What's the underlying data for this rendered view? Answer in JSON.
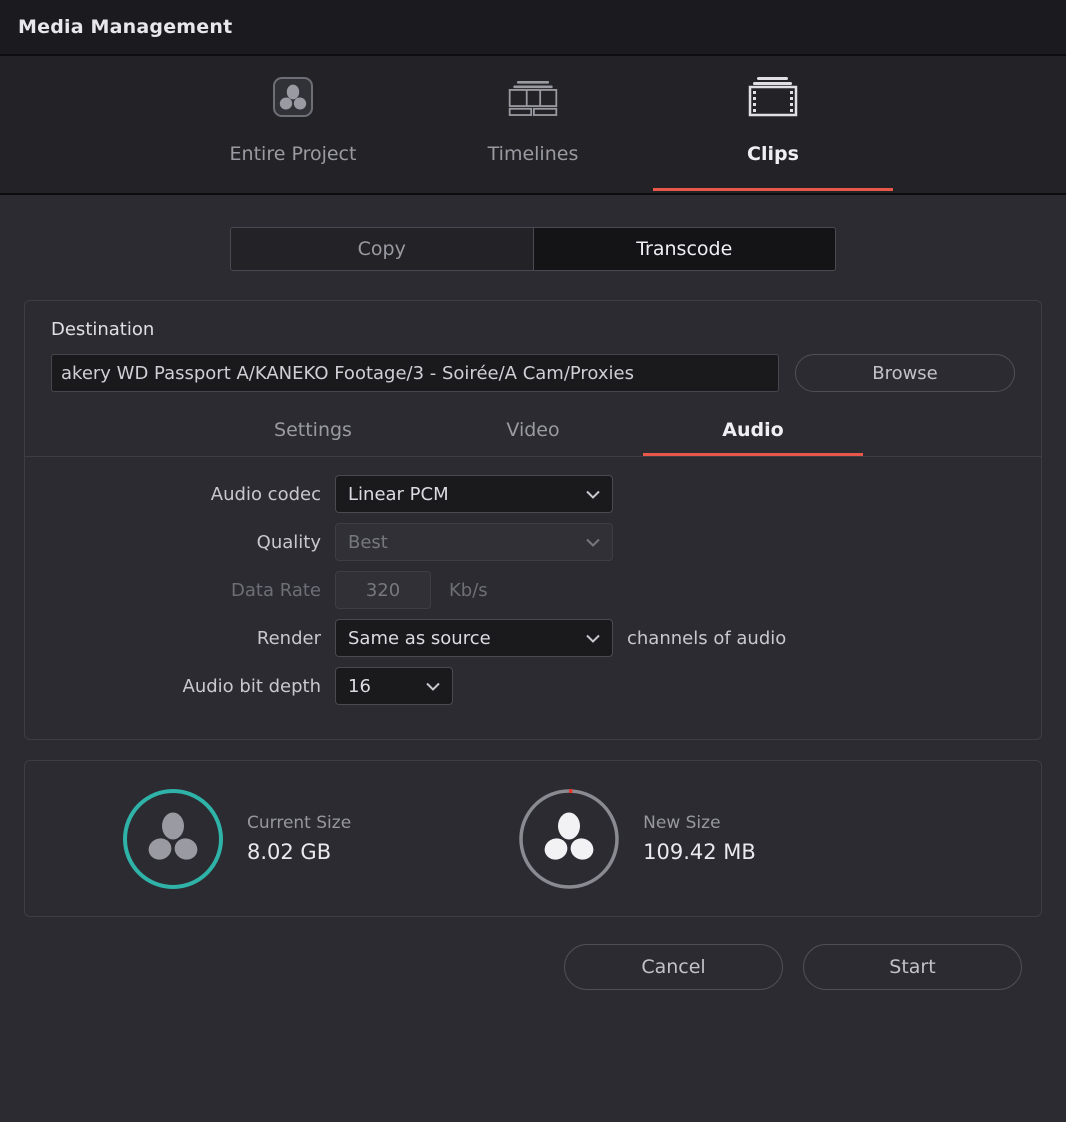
{
  "window": {
    "title": "Media Management"
  },
  "mode_tabs": [
    {
      "label": "Entire Project",
      "icon": "resolve-logo-icon",
      "active": false
    },
    {
      "label": "Timelines",
      "icon": "timeline-strip-icon",
      "active": false
    },
    {
      "label": "Clips",
      "icon": "filmstrip-icon",
      "active": true
    }
  ],
  "operation_toggle": {
    "options": [
      {
        "label": "Copy",
        "active": false
      },
      {
        "label": "Transcode",
        "active": true
      }
    ]
  },
  "destination": {
    "title": "Destination",
    "path_value": "akery WD Passport A/KANEKO Footage/3 - Soirée/A Cam/Proxies",
    "path_placeholder": "Choose a destination folder",
    "browse_label": "Browse"
  },
  "sub_tabs": [
    {
      "label": "Settings",
      "active": false
    },
    {
      "label": "Video",
      "active": false
    },
    {
      "label": "Audio",
      "active": true
    }
  ],
  "audio_form": {
    "audio_codec": {
      "label": "Audio codec",
      "value": "Linear PCM",
      "enabled": true,
      "icon": "chevron-down-icon"
    },
    "quality": {
      "label": "Quality",
      "value": "Best",
      "enabled": false,
      "icon": "chevron-down-icon"
    },
    "data_rate": {
      "label": "Data Rate",
      "value": "320",
      "units": "Kb/s",
      "enabled": false
    },
    "render": {
      "label": "Render",
      "value": "Same as source",
      "suffix": "channels of audio",
      "enabled": true,
      "icon": "chevron-down-icon"
    },
    "audio_bit_depth": {
      "label": "Audio bit depth",
      "value": "16",
      "enabled": true,
      "icon": "chevron-down-icon"
    }
  },
  "size_summary": {
    "current": {
      "caption": "Current Size",
      "value": "8.02 GB",
      "ring_color": "#2fb3a8",
      "icon": "resolve-logo-icon"
    },
    "new": {
      "caption": "New Size",
      "value": "109.42 MB",
      "ring_color": "#8a8a92",
      "accent_color": "#e8362a",
      "icon": "resolve-logo-icon"
    }
  },
  "footer": {
    "cancel_label": "Cancel",
    "start_label": "Start"
  },
  "colors": {
    "accent_red": "#e8584a",
    "teal": "#2fb3a8",
    "background": "#2b2b31",
    "titlebar": "#1b1b1f"
  }
}
